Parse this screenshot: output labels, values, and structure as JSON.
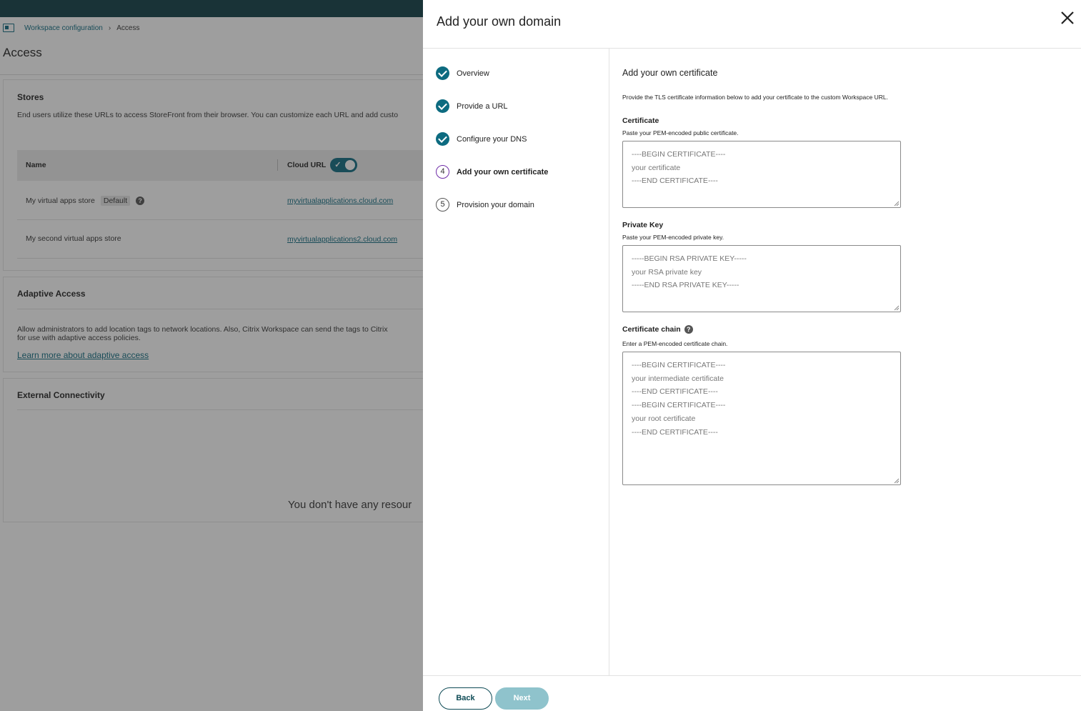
{
  "background": {
    "breadcrumb": {
      "parent": "Workspace configuration",
      "separator": "›",
      "current": "Access"
    },
    "page_title": "Access",
    "stores": {
      "title": "Stores",
      "description": "End users utilize these URLs to access StoreFront from their browser. You can customize each URL and add custo",
      "columns": {
        "name": "Name",
        "cloud_url": "Cloud URL"
      },
      "rows": [
        {
          "name": "My virtual apps store",
          "badge": "Default",
          "url": "myvirtualapplications.cloud.com"
        },
        {
          "name": "My second virtual apps store",
          "url": "myvirtualapplications2.cloud.com"
        }
      ]
    },
    "adaptive_access": {
      "title": "Adaptive Access",
      "description_line1": "Allow administrators to add location tags to network locations. Also, Citrix Workspace can send the tags to Citrix",
      "description_line2": "for use with adaptive access policies.",
      "link": "Learn more about adaptive access"
    },
    "external_connectivity": {
      "title": "External Connectivity",
      "empty_message": "You don't have any resour"
    }
  },
  "drawer": {
    "title": "Add your own domain",
    "steps": [
      {
        "label": "Overview",
        "status": "complete"
      },
      {
        "label": "Provide a URL",
        "status": "complete"
      },
      {
        "label": "Configure your DNS",
        "status": "complete"
      },
      {
        "label": "Add your own certificate",
        "status": "active",
        "number": "4"
      },
      {
        "label": "Provision your domain",
        "status": "pending",
        "number": "5"
      }
    ],
    "section_title": "Add your own certificate",
    "section_description": "Provide the TLS certificate information below to add your certificate to the custom Workspace URL.",
    "certificate": {
      "label": "Certificate",
      "help": "Paste your PEM-encoded public certificate.",
      "placeholder": [
        "----BEGIN CERTIFICATE----",
        "your certificate",
        "----END CERTIFICATE----"
      ]
    },
    "private_key": {
      "label": "Private Key",
      "help": "Paste your PEM-encoded private key.",
      "placeholder": [
        "-----BEGIN RSA PRIVATE KEY-----",
        "your RSA private key",
        "-----END RSA PRIVATE KEY-----"
      ]
    },
    "certificate_chain": {
      "label": "Certificate chain",
      "help": "Enter a PEM-encoded certificate chain.",
      "placeholder": [
        "----BEGIN CERTIFICATE----",
        "your intermediate certificate",
        "----END CERTIFICATE----",
        "----BEGIN CERTIFICATE----",
        "your root certificate",
        "----END CERTIFICATE----"
      ]
    },
    "buttons": {
      "back": "Back",
      "next": "Next"
    }
  },
  "colors": {
    "accent": "#0d6b80",
    "topbar": "#0d3d44",
    "active_step_ring": "#6f2da8",
    "next_disabled": "#8fc3cc"
  }
}
